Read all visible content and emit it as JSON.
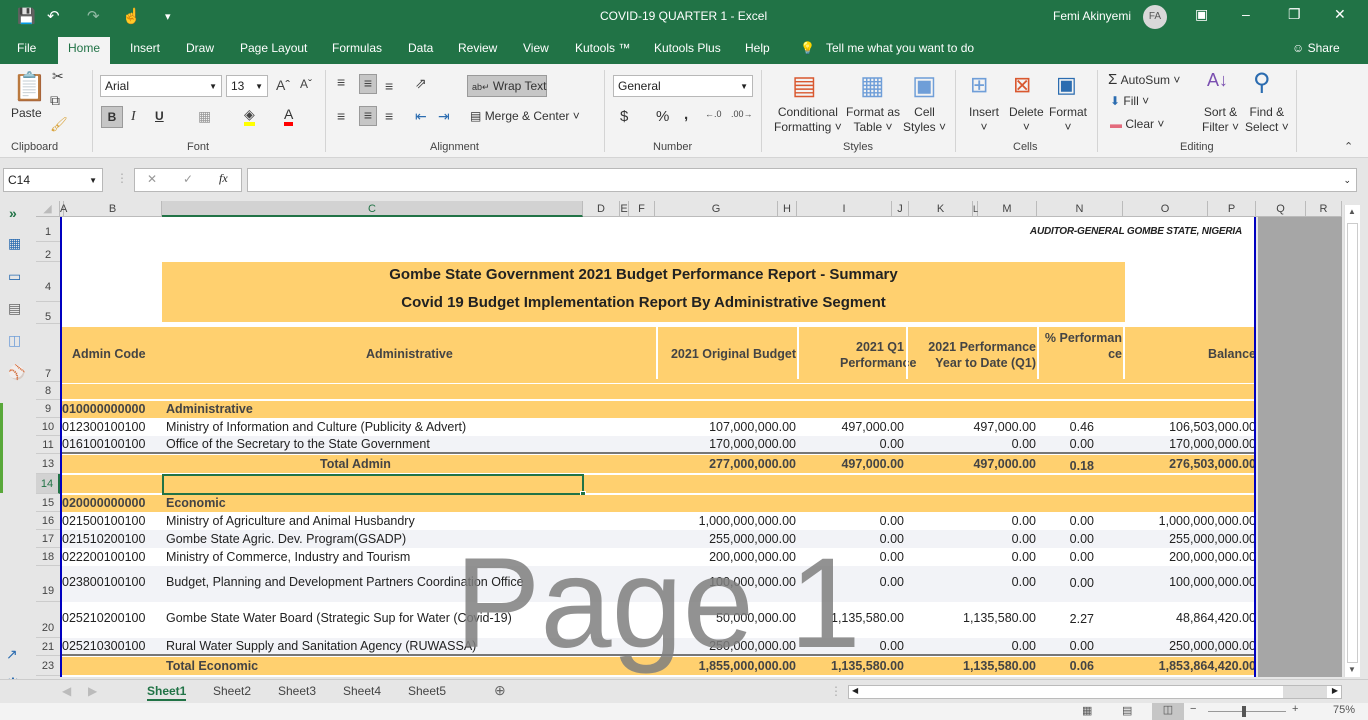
{
  "titlebar": {
    "title": "COVID-19 QUARTER 1  -  Excel",
    "user_name": "Femi Akinyemi",
    "user_initials": "FA"
  },
  "tabs": [
    "File",
    "Home",
    "Insert",
    "Draw",
    "Page Layout",
    "Formulas",
    "Data",
    "Review",
    "View",
    "Kutools ™",
    "Kutools Plus",
    "Help"
  ],
  "tell_me": "Tell me what you want to do",
  "share": "Share",
  "ribbon": {
    "clipboard": {
      "label": "Clipboard",
      "paste": "Paste"
    },
    "font": {
      "label": "Font",
      "name": "Arial",
      "size": "13",
      "bold": "B",
      "italic": "I",
      "underline": "U",
      "highlight_color": "#ffff00",
      "font_color": "#ff0000"
    },
    "alignment": {
      "label": "Alignment",
      "wrap_text": "Wrap Text",
      "merge_center": "Merge & Center"
    },
    "number": {
      "label": "Number",
      "format": "General",
      "currency": "$",
      "percent": "%",
      "comma": ","
    },
    "styles": {
      "label": "Styles",
      "conditional": [
        "Conditional",
        "Formatting"
      ],
      "format_table": [
        "Format as",
        "Table"
      ],
      "cell_styles": [
        "Cell",
        "Styles"
      ]
    },
    "cells": {
      "label": "Cells",
      "insert": "Insert",
      "delete": "Delete",
      "format": "Format"
    },
    "editing": {
      "label": "Editing",
      "autosum": "AutoSum",
      "fill": "Fill",
      "clear": "Clear",
      "sort_filter": [
        "Sort &",
        "Filter"
      ],
      "find_select": [
        "Find &",
        "Select"
      ]
    }
  },
  "formula_bar": {
    "name_box": "C14",
    "formula": "",
    "fx": "fx"
  },
  "columns": [
    "A",
    "B",
    "C",
    "D",
    "E",
    "F",
    "G",
    "H",
    "I",
    "J",
    "K",
    "L",
    "M",
    "N",
    "O",
    "P",
    "Q",
    "R"
  ],
  "selected_column": "C",
  "rows_visible": [
    "1",
    "2",
    "4",
    "5",
    "7",
    "8",
    "9",
    "10",
    "11",
    "13",
    "14",
    "15",
    "16",
    "17",
    "18",
    "19",
    "20",
    "21",
    "23"
  ],
  "selected_row": "14",
  "report": {
    "auditor": "AUDITOR-GENERAL GOMBE STATE, NIGERIA",
    "title1": "Gombe State Government 2021 Budget Performance Report - Summary",
    "title2": "Covid 19 Budget Implementation Report By Administrative Segment",
    "headers": {
      "code": "Admin Code",
      "admin": "Administrative",
      "budget": "2021 Original Budget",
      "q1": "2021 Q1 Performance",
      "ytd": "2021 Performance Year to Date (Q1)",
      "pct": "% Performance",
      "balance": "Balance"
    },
    "sections": [
      {
        "code": "010000000000",
        "name": "Administrative",
        "items": [
          {
            "code": "012300100100",
            "name": "Ministry of Information and Culture (Publicity & Advert)",
            "budget": "107,000,000.00",
            "q1": "497,000.00",
            "ytd": "497,000.00",
            "pct": "0.46",
            "balance": "106,503,000.00"
          },
          {
            "code": "016100100100",
            "name": "Office of the Secretary to the State Government",
            "budget": "170,000,000.00",
            "q1": "0.00",
            "ytd": "0.00",
            "pct": "0.00",
            "balance": "170,000,000.00"
          }
        ],
        "total": {
          "label": "Total Admin",
          "budget": "277,000,000.00",
          "q1": "497,000.00",
          "ytd": "497,000.00",
          "pct": "0.18",
          "balance": "276,503,000.00"
        }
      },
      {
        "code": "020000000000",
        "name": "Economic",
        "items": [
          {
            "code": "021500100100",
            "name": "Ministry of Agriculture and Animal Husbandry",
            "budget": "1,000,000,000.00",
            "q1": "0.00",
            "ytd": "0.00",
            "pct": "0.00",
            "balance": "1,000,000,000.00"
          },
          {
            "code": "021510200100",
            "name": "Gombe State Agric. Dev. Program(GSADP)",
            "budget": "255,000,000.00",
            "q1": "0.00",
            "ytd": "0.00",
            "pct": "0.00",
            "balance": "255,000,000.00"
          },
          {
            "code": "022200100100",
            "name": "Ministry of Commerce, Industry and Tourism",
            "budget": "200,000,000.00",
            "q1": "0.00",
            "ytd": "0.00",
            "pct": "0.00",
            "balance": "200,000,000.00"
          },
          {
            "code": "023800100100",
            "name": "Budget, Planning and Development Partners Coordination Office",
            "budget": "100,000,000.00",
            "q1": "0.00",
            "ytd": "0.00",
            "pct": "0.00",
            "balance": "100,000,000.00"
          },
          {
            "code": "025210200100",
            "name": "Gombe State Water Board (Strategic Sup for Water (Covid-19)",
            "budget": "50,000,000.00",
            "q1": "1,135,580.00",
            "ytd": "1,135,580.00",
            "pct": "2.27",
            "balance": "48,864,420.00"
          },
          {
            "code": "025210300100",
            "name": "Rural Water Supply and Sanitation Agency (RUWASSA)",
            "budget": "250,000,000.00",
            "q1": "0.00",
            "ytd": "0.00",
            "pct": "0.00",
            "balance": "250,000,000.00"
          }
        ],
        "total": {
          "label": "Total Economic",
          "budget": "1,855,000,000.00",
          "q1": "1,135,580.00",
          "ytd": "1,135,580.00",
          "pct": "0.06",
          "balance": "1,853,864,420.00"
        }
      }
    ]
  },
  "watermark": "Page 1",
  "sheet_tabs": [
    "Sheet1",
    "Sheet2",
    "Sheet3",
    "Sheet4",
    "Sheet5"
  ],
  "active_sheet": "Sheet1",
  "zoom": "75%",
  "accent": "#217346",
  "band_color": "#ffd06f"
}
